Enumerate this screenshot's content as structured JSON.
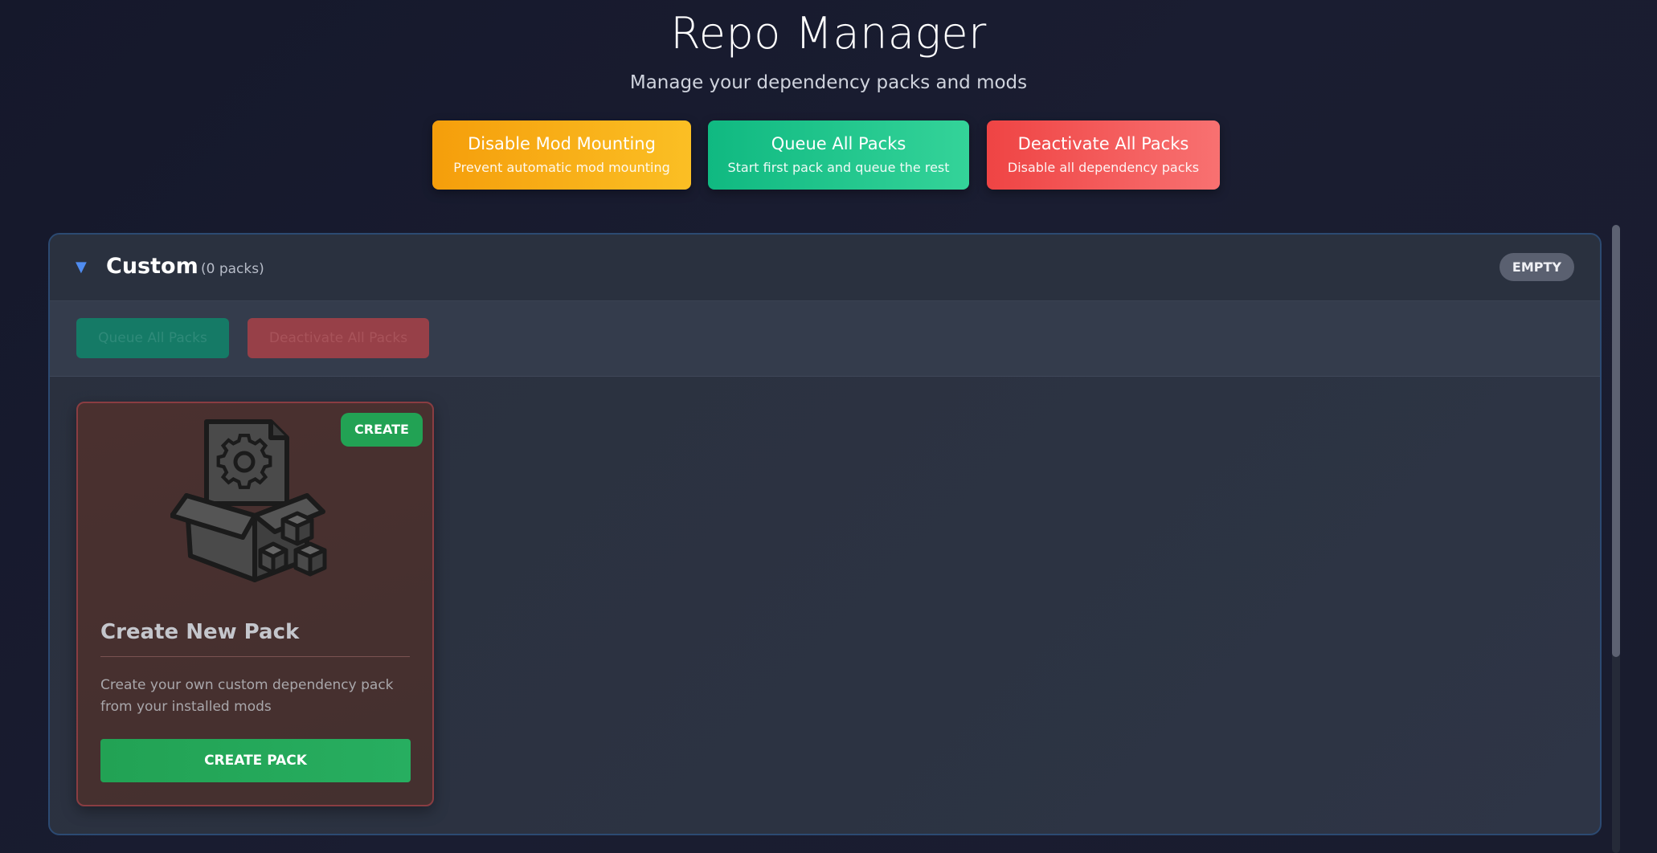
{
  "header": {
    "title": "Repo Manager",
    "subtitle": "Manage your dependency packs and mods"
  },
  "actions": {
    "disable_mounting": {
      "label": "Disable Mod Mounting",
      "sub": "Prevent automatic mod mounting"
    },
    "queue_all": {
      "label": "Queue All Packs",
      "sub": "Start first pack and queue the rest"
    },
    "deactivate_all": {
      "label": "Deactivate All Packs",
      "sub": "Disable all dependency packs"
    }
  },
  "section": {
    "caret": "▼",
    "title": "Custom",
    "count": "(0 packs)",
    "badge": "EMPTY",
    "toolbar": {
      "queue_label": "Queue All Packs",
      "deactivate_label": "Deactivate All Packs"
    }
  },
  "card": {
    "badge": "CREATE",
    "icon": "package-gear-icon",
    "title": "Create New Pack",
    "description": "Create your own custom dependency pack from your installed mods",
    "button": "CREATE PACK"
  },
  "colors": {
    "yellow": "#f59e0b",
    "green": "#10b981",
    "red": "#ef4444",
    "accent_blue": "#4f8cf0",
    "create_green": "#22a254"
  }
}
